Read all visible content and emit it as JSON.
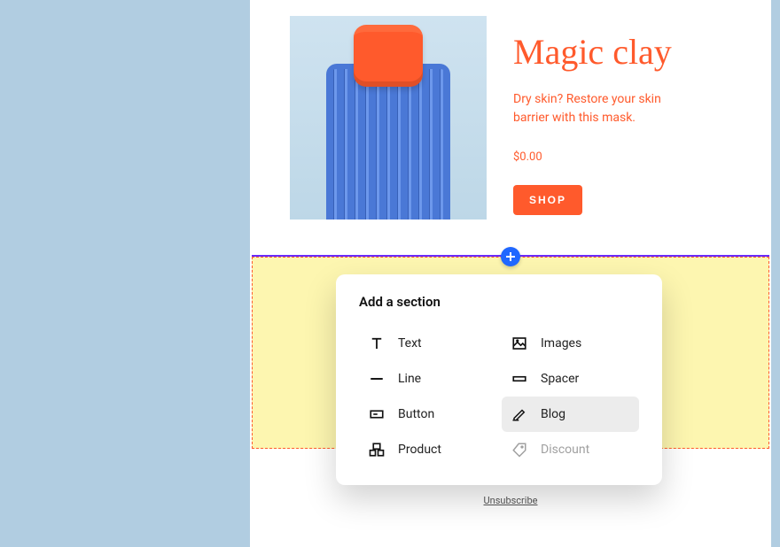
{
  "product": {
    "title": "Magic clay",
    "description": "Dry skin? Restore your skin barrier with this mask.",
    "price": "$0.00",
    "cta": "SHOP"
  },
  "unsubscribe_label": "Unsubscribe",
  "popover": {
    "title": "Add a section",
    "options": {
      "text": "Text",
      "images": "Images",
      "line": "Line",
      "spacer": "Spacer",
      "button": "Button",
      "blog": "Blog",
      "product": "Product",
      "discount": "Discount"
    }
  }
}
